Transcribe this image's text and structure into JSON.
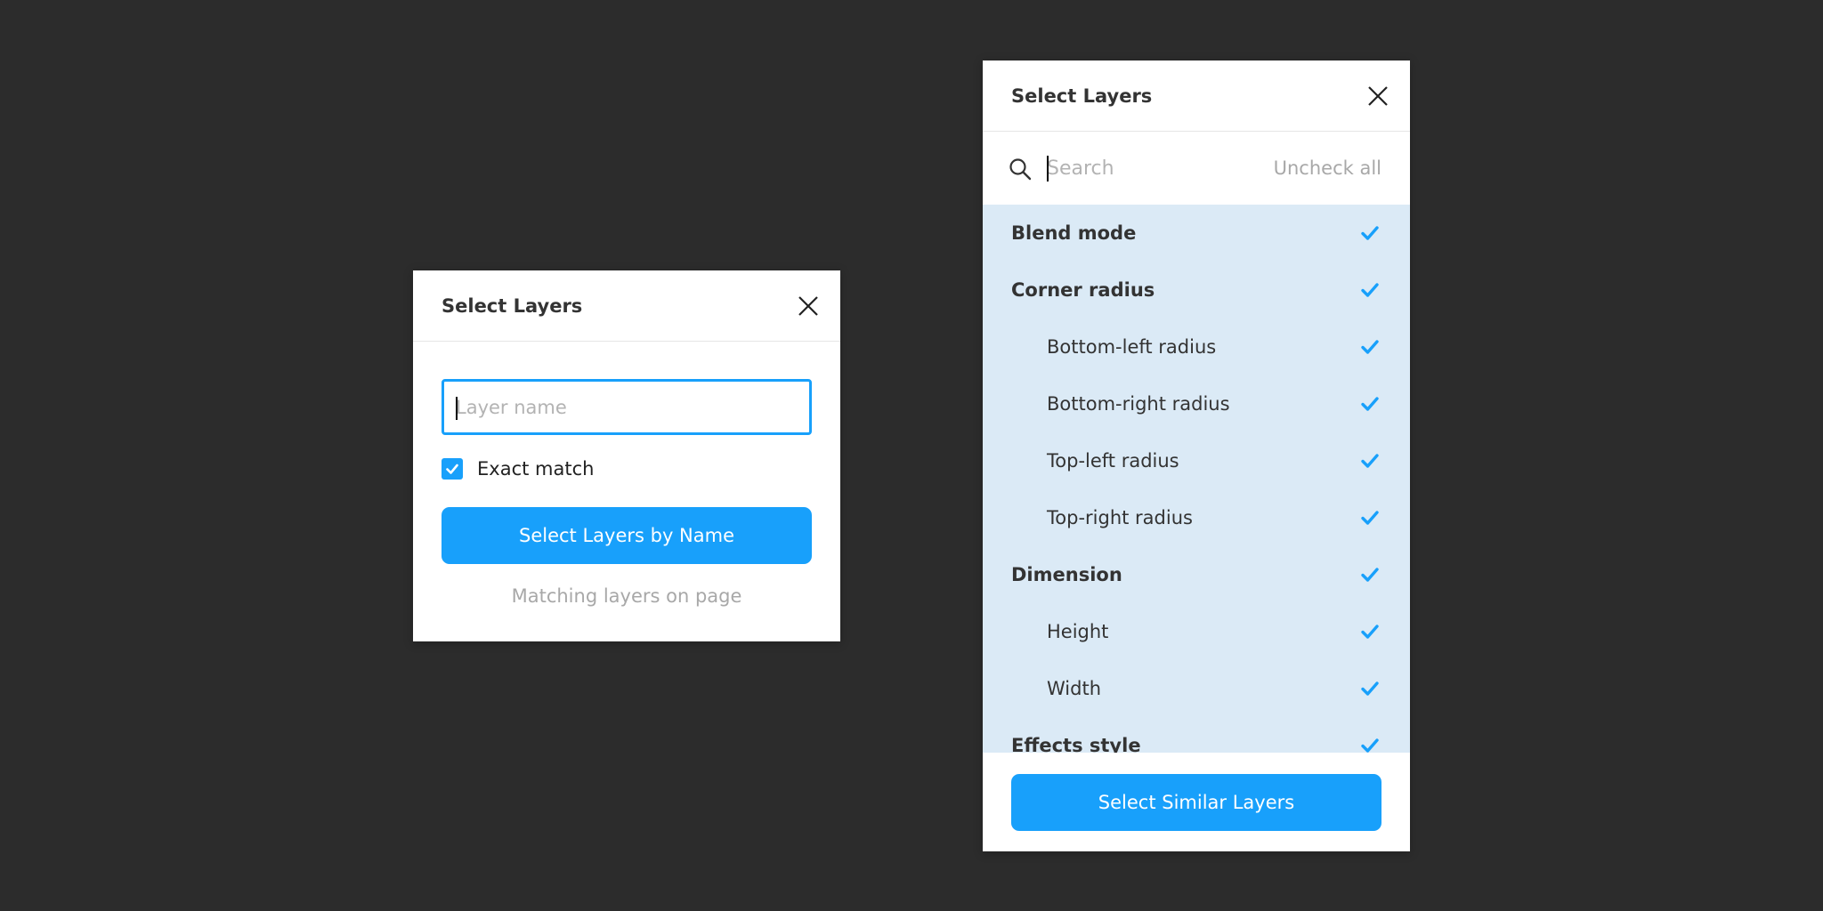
{
  "name_dialog": {
    "title": "Select Layers",
    "close_icon": "close-icon",
    "input_placeholder": "Layer name",
    "input_value": "",
    "exact_match_label": "Exact match",
    "exact_match_checked": true,
    "button_label": "Select Layers by Name",
    "status_text": "Matching layers on page"
  },
  "similar_dialog": {
    "title": "Select Layers",
    "close_icon": "close-icon",
    "search_icon": "search-icon",
    "search_placeholder": "Search",
    "search_value": "",
    "uncheck_all_label": "Uncheck all",
    "items": [
      {
        "label": "Blend mode",
        "level": "parent",
        "checked": true
      },
      {
        "label": "Corner radius",
        "level": "parent",
        "checked": true
      },
      {
        "label": "Bottom-left radius",
        "level": "child",
        "checked": true
      },
      {
        "label": "Bottom-right radius",
        "level": "child",
        "checked": true
      },
      {
        "label": "Top-left radius",
        "level": "child",
        "checked": true
      },
      {
        "label": "Top-right radius",
        "level": "child",
        "checked": true
      },
      {
        "label": "Dimension",
        "level": "parent",
        "checked": true
      },
      {
        "label": "Height",
        "level": "child",
        "checked": true
      },
      {
        "label": "Width",
        "level": "child",
        "checked": true
      },
      {
        "label": "Effects style",
        "level": "parent",
        "checked": true
      }
    ],
    "button_label": "Select Similar Layers"
  },
  "colors": {
    "background": "#2c2c2c",
    "accent": "#18a0fb",
    "list_background": "#dbeaf6",
    "muted_text": "#a8a8a8"
  }
}
